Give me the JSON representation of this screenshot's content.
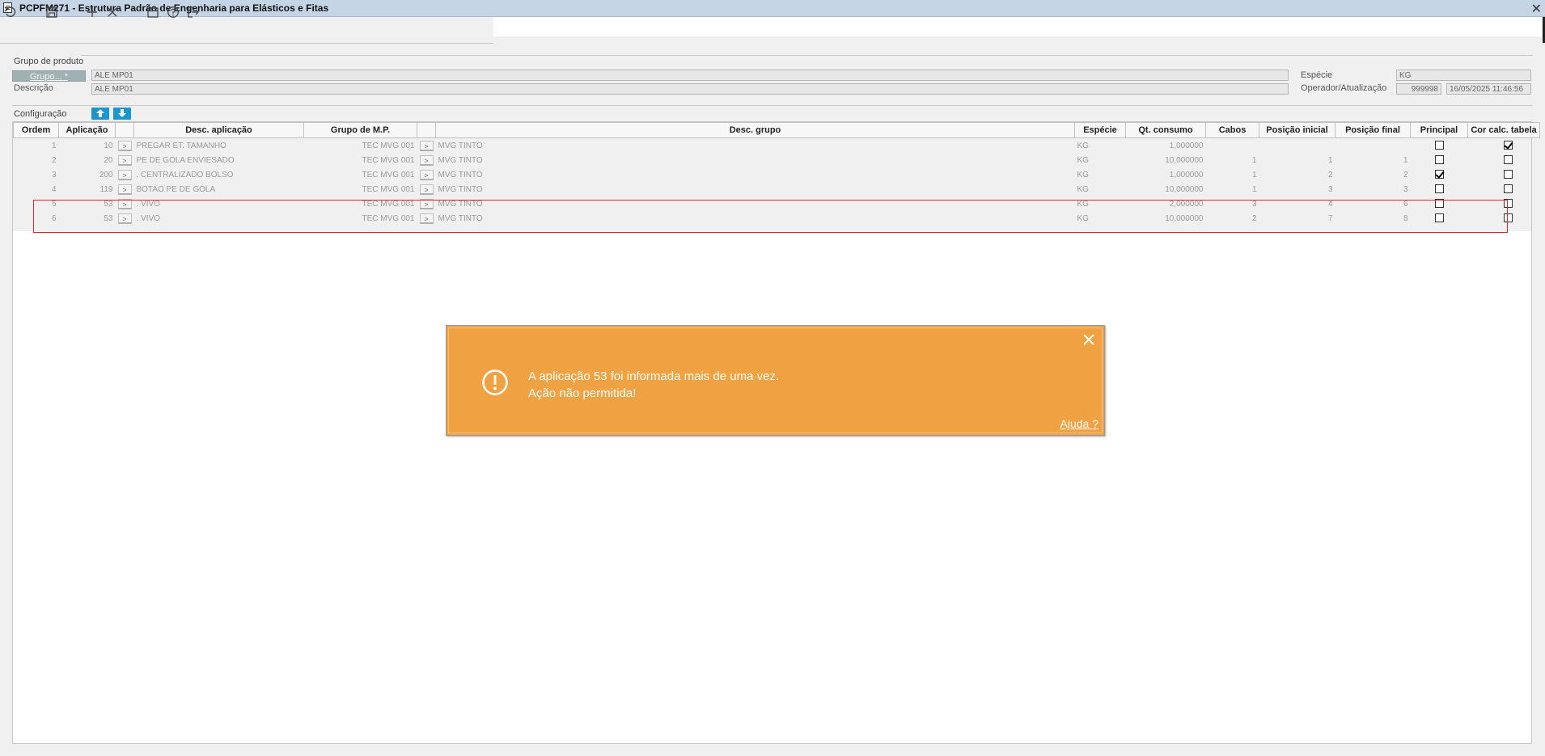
{
  "window": {
    "title": "PCPFM271 - Estrutura Padrão de Engenharia para Elásticos e Fitas",
    "close": "✕"
  },
  "toolbar": {
    "icons": [
      "undo-icon",
      "save-icon",
      "add-icon",
      "delete-icon",
      "calendar-icon",
      "help-icon",
      "exit-icon"
    ]
  },
  "product_group": {
    "section_title": "Grupo de produto",
    "group_label": "Grupo... *",
    "group_value": "ALE MP01",
    "description_label": "Descrição",
    "description_value": "ALE MP01",
    "species_label": "Espécie",
    "species_value": "KG",
    "operator_label": "Operador/Atualização",
    "operator_value": "999998",
    "updated_value": "16/05/2025 11:46:56"
  },
  "configuration": {
    "section_title": "Configuração",
    "columns": [
      "Ordem",
      "Aplicação",
      "Desc. aplicação",
      "Grupo de M.P.",
      "Desc. grupo",
      "Espécie",
      "Qt. consumo",
      "Cabos",
      "Posição inicial",
      "Posição final",
      "Principal",
      "Cor calc. tabela"
    ],
    "button_label": ">",
    "rows": [
      {
        "ordem": "1",
        "aplicacao": "10",
        "desc_aplicacao": "PREGAR ET. TAMANHO",
        "grupo_mp": "TEC MVG 001",
        "desc_grupo": "MVG TINTO",
        "especie": "KG",
        "qt_consumo": "1,000000",
        "cabos": "",
        "pos_inicial": "",
        "pos_final": "",
        "principal": false,
        "cor_calc": true
      },
      {
        "ordem": "2",
        "aplicacao": "20",
        "desc_aplicacao": "PE DE GOLA ENVIESADO",
        "grupo_mp": "TEC MVG 001",
        "desc_grupo": "MVG TINTO",
        "especie": "KG",
        "qt_consumo": "10,000000",
        "cabos": "1",
        "pos_inicial": "1",
        "pos_final": "1",
        "principal": false,
        "cor_calc": false
      },
      {
        "ordem": "3",
        "aplicacao": "200",
        "desc_aplicacao": ". CENTRALIZADO BOLSO",
        "grupo_mp": "TEC MVG 001",
        "desc_grupo": "MVG TINTO",
        "especie": "KG",
        "qt_consumo": "1,000000",
        "cabos": "1",
        "pos_inicial": "2",
        "pos_final": "2",
        "principal": true,
        "cor_calc": false
      },
      {
        "ordem": "4",
        "aplicacao": "119",
        "desc_aplicacao": "BOTAO PE DE GOLA",
        "grupo_mp": "TEC MVG 001",
        "desc_grupo": "MVG TINTO",
        "especie": "KG",
        "qt_consumo": "10,000000",
        "cabos": "1",
        "pos_inicial": "3",
        "pos_final": "3",
        "principal": false,
        "cor_calc": false
      },
      {
        "ordem": "5",
        "aplicacao": "53",
        "desc_aplicacao": ". VIVO",
        "grupo_mp": "TEC MVG 001",
        "desc_grupo": "MVG TINTO",
        "especie": "KG",
        "qt_consumo": "2,000000",
        "cabos": "3",
        "pos_inicial": "4",
        "pos_final": "6",
        "principal": false,
        "cor_calc": false
      },
      {
        "ordem": "6",
        "aplicacao": "53",
        "desc_aplicacao": ". VIVO",
        "grupo_mp": "TEC MVG 001",
        "desc_grupo": "MVG TINTO",
        "especie": "KG",
        "qt_consumo": "10,000000",
        "cabos": "2",
        "pos_inicial": "7",
        "pos_final": "8",
        "principal": false,
        "cor_calc": false
      }
    ]
  },
  "alert": {
    "line1": "A aplicação 53 foi informada mais de uma vez.",
    "line2": "Ação não permitida!",
    "help": "Ajuda ?",
    "color": "#f0a141"
  },
  "colors": {
    "titlebar": "#c5d5e6",
    "accent": "#1a95cf",
    "highlight": "#e4262d"
  }
}
